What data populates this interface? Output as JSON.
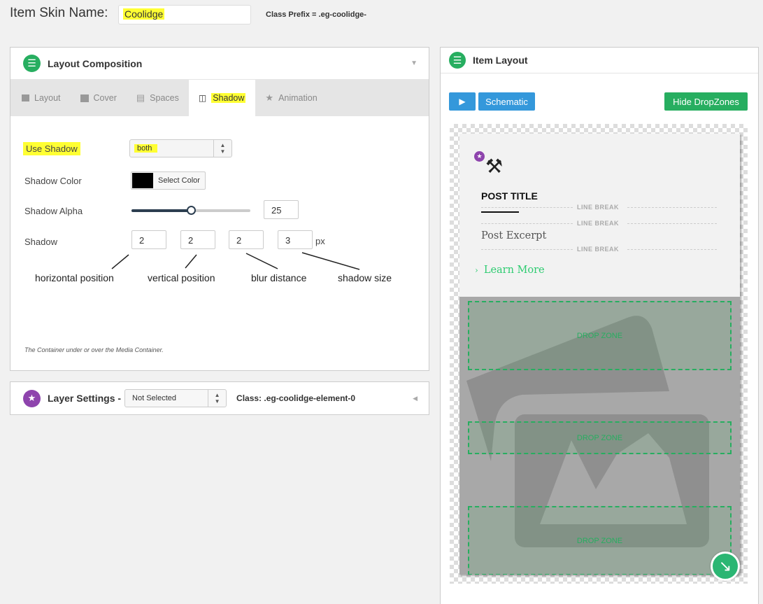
{
  "header": {
    "skin_name_label": "Item Skin Name:",
    "skin_name_value": "Coolidge",
    "class_prefix": "Class Prefix = .eg-coolidge-"
  },
  "layout_composition": {
    "title": "Layout Composition",
    "tabs": [
      {
        "label": "Layout",
        "icon": "columns-icon"
      },
      {
        "label": "Cover",
        "icon": "square-icon"
      },
      {
        "label": "Spaces",
        "icon": "spaces-icon"
      },
      {
        "label": "Shadow",
        "icon": "shadow-icon",
        "active": true
      },
      {
        "label": "Animation",
        "icon": "star-icon"
      }
    ],
    "use_shadow_label": "Use Shadow",
    "use_shadow_value": "both",
    "shadow_color_label": "Shadow Color",
    "shadow_color_value": "#000000",
    "select_color_label": "Select Color",
    "shadow_alpha_label": "Shadow Alpha",
    "shadow_alpha_value": "25",
    "shadow_alpha_slider": 0.5,
    "shadow_label": "Shadow",
    "shadow_values": [
      "2",
      "2",
      "2",
      "3"
    ],
    "shadow_unit": "px",
    "note": "The Container under or over the Media Container."
  },
  "annotations": {
    "horizontal": "horizontal position",
    "vertical": "vertical position",
    "blur": "blur distance",
    "size": "shadow size"
  },
  "layer_settings": {
    "title": "Layer Settings -",
    "select_value": "Not Selected",
    "class_text": "Class: .eg-coolidge-element-0"
  },
  "item_layout": {
    "title": "Item Layout",
    "schematic_label": "Schematic",
    "hide_dropzones_label": "Hide DropZones",
    "post_title": "POST TITLE",
    "line_break": "LINE BREAK",
    "post_excerpt": "Post Excerpt",
    "learn_more": "Learn More",
    "drop_zone": "DROP ZONE"
  },
  "colors": {
    "accent_green": "#27ae60",
    "accent_blue": "#3498db",
    "accent_purple": "#8e44ad",
    "highlight": "#ffff33"
  }
}
